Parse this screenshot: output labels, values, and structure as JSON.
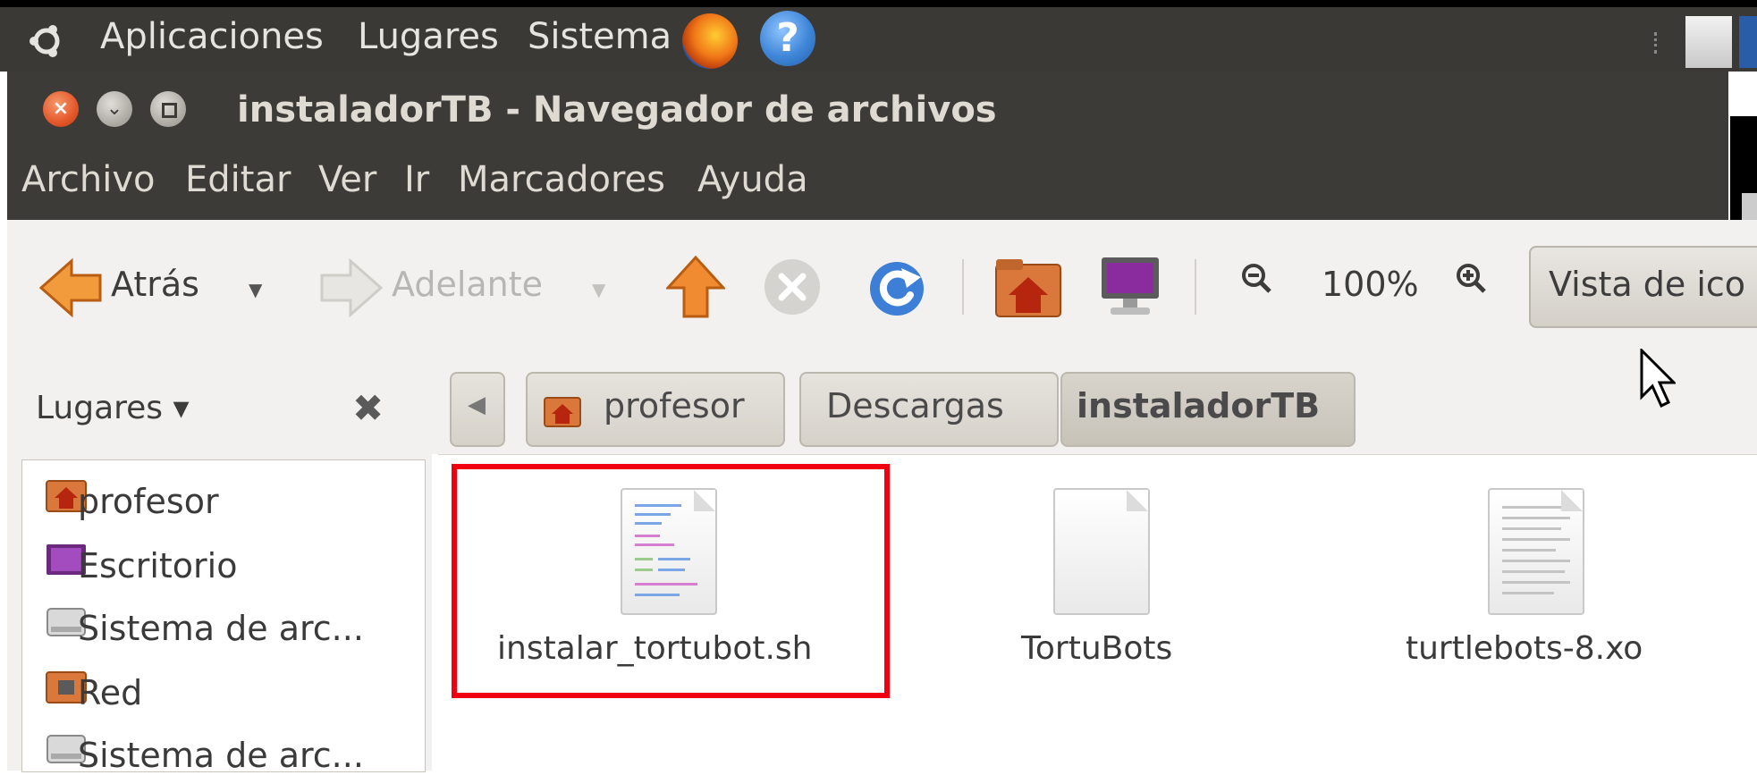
{
  "top_panel": {
    "menus": [
      "Aplicaciones",
      "Lugares",
      "Sistema"
    ],
    "icons": [
      "ubuntu-logo-icon",
      "firefox-icon",
      "help-icon"
    ],
    "help_glyph": "?"
  },
  "window": {
    "title": "instaladorTB - Navegador de archivos",
    "controls": [
      "close",
      "minimize",
      "maximize"
    ]
  },
  "menubar": [
    "Archivo",
    "Editar",
    "Ver",
    "Ir",
    "Marcadores",
    "Ayuda"
  ],
  "toolbar": {
    "back_label": "Atrás",
    "forward_label": "Adelante",
    "zoom_level": "100%",
    "view_mode": "Vista de ico"
  },
  "sidepane": {
    "header": "Lugares ▾",
    "items": [
      {
        "label": "profesor",
        "icon": "home-folder-icon"
      },
      {
        "label": "Escritorio",
        "icon": "desktop-icon"
      },
      {
        "label": "Sistema de arc...",
        "icon": "drive-icon"
      },
      {
        "label": "Red",
        "icon": "network-icon"
      },
      {
        "label": "Sistema de arc...",
        "icon": "drive-icon"
      }
    ]
  },
  "breadcrumbs": [
    "profesor",
    "Descargas",
    "instaladorTB"
  ],
  "files": [
    {
      "name": "instalar_tortubot.sh",
      "icon": "script-file-icon",
      "selected": true
    },
    {
      "name": "TortuBots",
      "icon": "blank-file-icon",
      "selected": false
    },
    {
      "name": "turtlebots-8.xo",
      "icon": "text-file-icon",
      "selected": false
    }
  ],
  "colors": {
    "panel": "#3a3936",
    "titlebar": "#3c3b37",
    "toolbar_bg": "#f2f1f0",
    "accent_orange": "#e4572a",
    "selection_box": "#f00010"
  }
}
